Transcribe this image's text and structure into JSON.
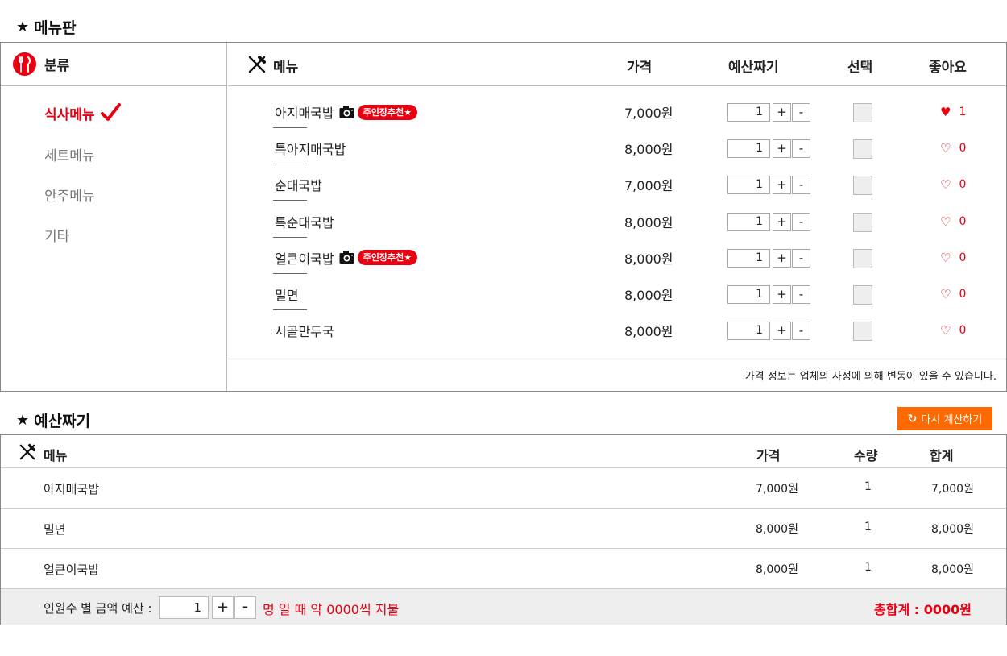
{
  "board": {
    "title": "메뉴판",
    "category_header": "분류",
    "categories": [
      {
        "label": "식사메뉴",
        "active": true
      },
      {
        "label": "세트메뉴",
        "active": false
      },
      {
        "label": "안주메뉴",
        "active": false
      },
      {
        "label": "기타",
        "active": false
      }
    ],
    "columns": {
      "menu": "메뉴",
      "price": "가격",
      "budget": "예산짜기",
      "select": "선택",
      "like": "좋아요"
    },
    "items": [
      {
        "name": "아지매국밥",
        "camera": true,
        "badge": "주인장추천★",
        "price": "7,000원",
        "qty": "1",
        "plus": "+",
        "minus": "-",
        "liked": true,
        "likes": "1"
      },
      {
        "name": "특아지매국밥",
        "camera": false,
        "badge": "",
        "price": "8,000원",
        "qty": "1",
        "plus": "+",
        "minus": "-",
        "liked": false,
        "likes": "0"
      },
      {
        "name": "순대국밥",
        "camera": false,
        "badge": "",
        "price": "7,000원",
        "qty": "1",
        "plus": "+",
        "minus": "-",
        "liked": false,
        "likes": "0"
      },
      {
        "name": "특순대국밥",
        "camera": false,
        "badge": "",
        "price": "8,000원",
        "qty": "1",
        "plus": "+",
        "minus": "-",
        "liked": false,
        "likes": "0"
      },
      {
        "name": "얼큰이국밥",
        "camera": true,
        "badge": "주인장추천★",
        "price": "8,000원",
        "qty": "1",
        "plus": "+",
        "minus": "-",
        "liked": false,
        "likes": "0"
      },
      {
        "name": "밀면",
        "camera": false,
        "badge": "",
        "price": "8,000원",
        "qty": "1",
        "plus": "+",
        "minus": "-",
        "liked": false,
        "likes": "0"
      },
      {
        "name": "시골만두국",
        "camera": false,
        "badge": "",
        "price": "8,000원",
        "qty": "1",
        "plus": "+",
        "minus": "-",
        "liked": false,
        "likes": "0"
      }
    ],
    "notice": "가격 정보는 업체의 사정에 의해 변동이 있을 수 있습니다."
  },
  "budget": {
    "title": "예산짜기",
    "recalc_button": "다시 계산하기",
    "columns": {
      "menu": "메뉴",
      "price": "가격",
      "qty": "수량",
      "total": "합계"
    },
    "rows": [
      {
        "name": "아지매국밥",
        "price": "7,000원",
        "qty": "1",
        "total": "7,000원"
      },
      {
        "name": "밀면",
        "price": "8,000원",
        "qty": "1",
        "total": "8,000원"
      },
      {
        "name": "얼큰이국밥",
        "price": "8,000원",
        "qty": "1",
        "total": "8,000원"
      }
    ],
    "footer": {
      "label": "인원수 별 금액 예산 :",
      "people": "1",
      "plus": "+",
      "minus": "-",
      "message": "명 일 때 약 0000씩 지불",
      "grand_total": "총합계 : 0000원"
    }
  },
  "colors": {
    "accent_red": "#e60012",
    "orange": "#ff6a00",
    "footer_bg": "#eeeeee"
  },
  "icons": {
    "star": "★",
    "heart_filled": "♥",
    "heart_empty": "♡",
    "refresh": "↻"
  }
}
